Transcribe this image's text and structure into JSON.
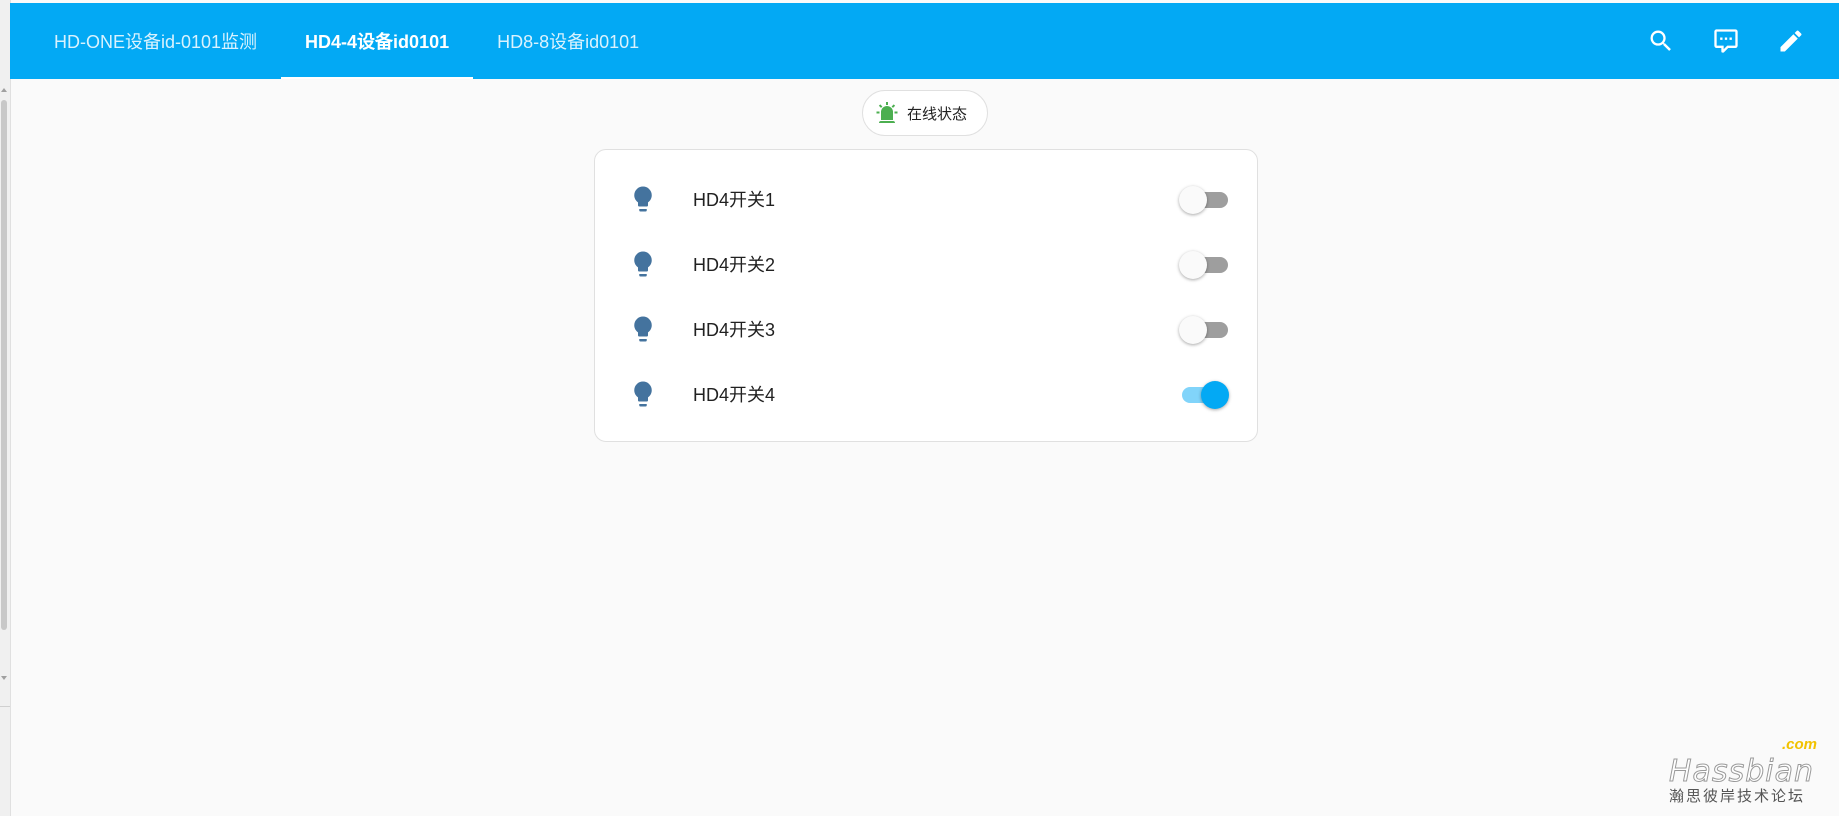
{
  "header": {
    "tabs": [
      {
        "label": "HD-ONE设备id-0101监测",
        "active": false
      },
      {
        "label": "HD4-4设备id0101",
        "active": true
      },
      {
        "label": "HD8-8设备id0101",
        "active": false
      }
    ],
    "actions": [
      {
        "icon": "search-icon"
      },
      {
        "icon": "assist-chat-icon"
      },
      {
        "icon": "pencil-icon"
      }
    ],
    "background_color": "#03a9f4"
  },
  "badge": {
    "label": "在线状态",
    "icon": "alarm-light-icon",
    "icon_color": "#4caf50"
  },
  "entities": [
    {
      "name": "HD4开关1",
      "icon": "lightbulb-icon",
      "state": "off"
    },
    {
      "name": "HD4开关2",
      "icon": "lightbulb-icon",
      "state": "off"
    },
    {
      "name": "HD4开关3",
      "icon": "lightbulb-icon",
      "state": "off"
    },
    {
      "name": "HD4开关4",
      "icon": "lightbulb-icon",
      "state": "on"
    }
  ],
  "colors": {
    "accent": "#03a9f4",
    "icon": "#44739e",
    "toggle_off_track": "#9e9e9e",
    "toggle_on_track": "#81d4fa"
  },
  "watermark": {
    "main": "Hassbian",
    "suffix": ".com",
    "subtitle": "瀚思彼岸技术论坛"
  }
}
